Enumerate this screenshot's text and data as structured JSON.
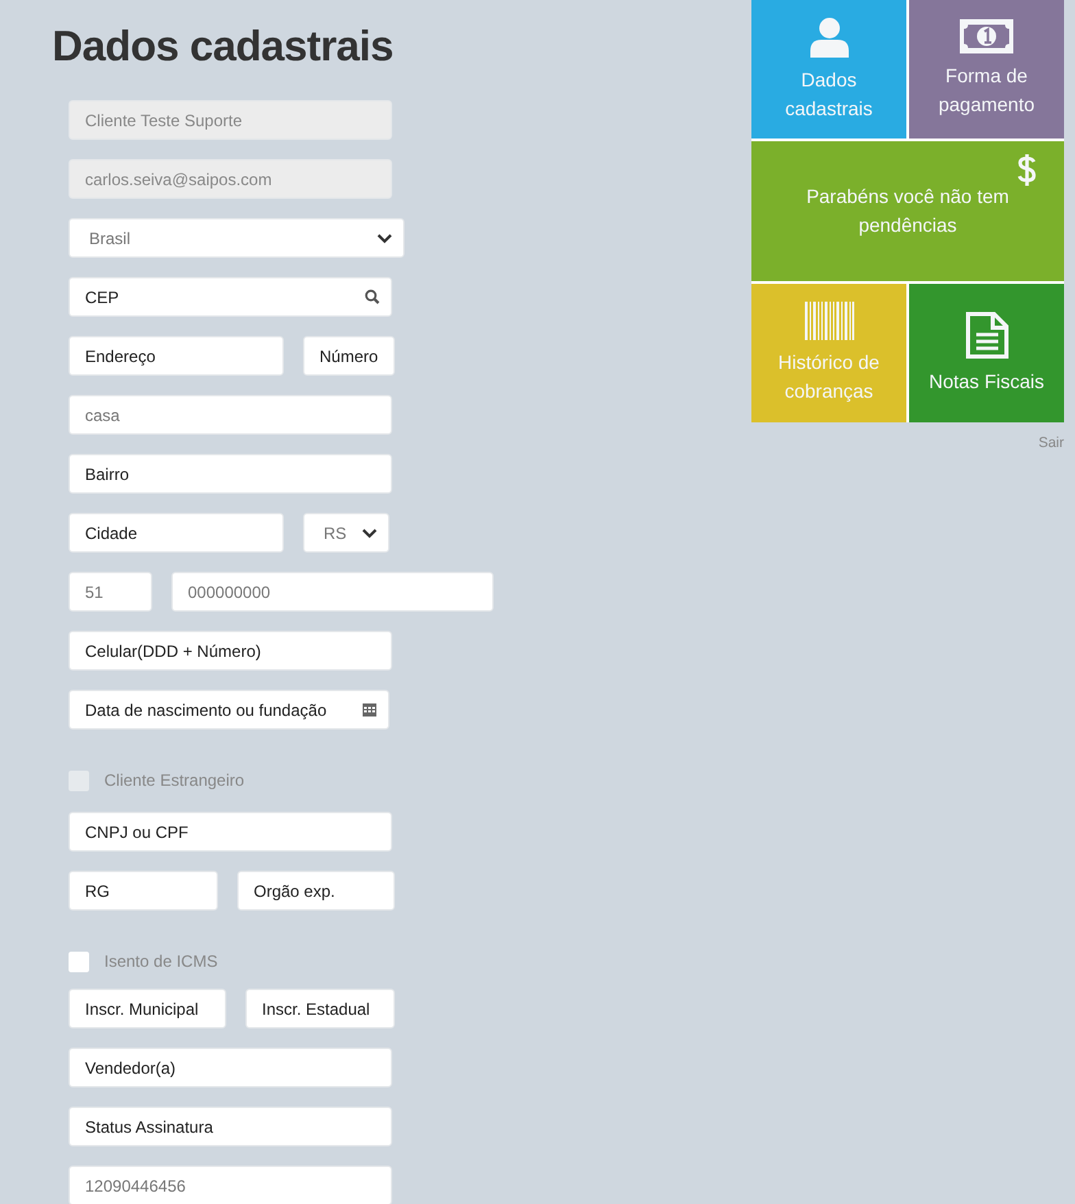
{
  "title": "Dados cadastrais",
  "form": [
    {
      "kind": "row",
      "fields": [
        {
          "kind": "text",
          "value": "Cliente Teste Suporte",
          "disabled": true
        }
      ]
    },
    {
      "kind": "row",
      "fields": [
        {
          "kind": "text",
          "value": "carlos.seiva@saipos.com",
          "disabled": true
        }
      ]
    },
    {
      "kind": "row",
      "fields": [
        {
          "kind": "select",
          "value": "Brasil",
          "disabled": false
        }
      ]
    },
    {
      "kind": "row",
      "fields": [
        {
          "kind": "search",
          "placeholder": "CEP",
          "disabled": false
        }
      ]
    },
    {
      "kind": "row",
      "fields": [
        {
          "kind": "text",
          "placeholder": "Endereço",
          "disabled": false
        },
        {
          "kind": "text",
          "placeholder": "Número",
          "disabled": false
        }
      ]
    },
    {
      "kind": "row",
      "fields": [
        {
          "kind": "text",
          "value": "casa",
          "disabled": false
        }
      ]
    },
    {
      "kind": "row",
      "fields": [
        {
          "kind": "text",
          "placeholder": "Bairro",
          "disabled": false
        }
      ]
    },
    {
      "kind": "row",
      "fields": [
        {
          "kind": "text",
          "placeholder": "Cidade",
          "disabled": false
        },
        {
          "kind": "select",
          "value": "RS",
          "disabled": false
        }
      ]
    },
    {
      "kind": "row",
      "fields": [
        {
          "kind": "text",
          "value": "51",
          "disabled": false
        },
        {
          "kind": "text",
          "value": "000000000",
          "disabled": false
        }
      ]
    },
    {
      "kind": "row",
      "fields": [
        {
          "kind": "text",
          "placeholder": "Celular(DDD + Número)",
          "disabled": false
        }
      ]
    },
    {
      "kind": "row",
      "fields": [
        {
          "kind": "date",
          "placeholder": "Data de nascimento ou fundação",
          "disabled": false
        }
      ]
    },
    {
      "kind": "checkbox",
      "label": "Cliente Estrangeiro",
      "checked": false,
      "disabled": true
    },
    {
      "kind": "row",
      "fields": [
        {
          "kind": "text",
          "placeholder": "CNPJ ou CPF",
          "disabled": false
        }
      ]
    },
    {
      "kind": "row",
      "fields": [
        {
          "kind": "text",
          "placeholder": "RG",
          "disabled": false
        },
        {
          "kind": "text",
          "placeholder": "Orgão exp.",
          "disabled": false
        }
      ]
    },
    {
      "kind": "checkbox",
      "label": "Isento de ICMS",
      "checked": false,
      "disabled": false
    },
    {
      "kind": "row",
      "fields": [
        {
          "kind": "text",
          "placeholder": "Inscr. Municipal",
          "disabled": false
        },
        {
          "kind": "text",
          "placeholder": "Inscr. Estadual",
          "disabled": false
        }
      ]
    },
    {
      "kind": "row",
      "fields": [
        {
          "kind": "text",
          "placeholder": "Vendedor(a)",
          "disabled": false
        }
      ]
    },
    {
      "kind": "row",
      "fields": [
        {
          "kind": "text",
          "placeholder": "Status Assinatura",
          "disabled": false
        }
      ]
    },
    {
      "kind": "row",
      "fields": [
        {
          "kind": "text",
          "value": "12090446456",
          "disabled": false
        }
      ]
    }
  ],
  "tiles": [
    {
      "kind": "user",
      "label": "Dados cadastrais",
      "color": "#29abe2"
    },
    {
      "kind": "money",
      "label": "Forma de pagamento",
      "color": "#85769a"
    },
    {
      "kind": "dollar",
      "label": "Parabéns você não tem pendências",
      "color": "#7bb02b"
    },
    {
      "kind": "barcode",
      "label": "Histórico de cobranças",
      "color": "#dbc02b"
    },
    {
      "kind": "document",
      "label": "Notas Fiscais",
      "color": "#33962d"
    }
  ],
  "logout": "Sair"
}
